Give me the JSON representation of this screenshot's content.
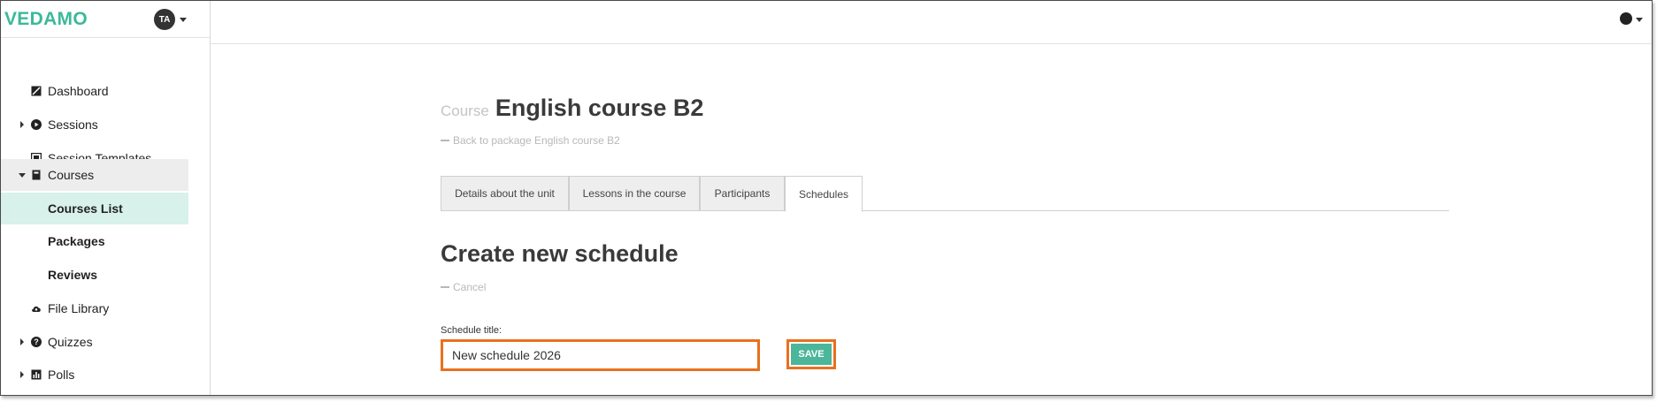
{
  "brand": {
    "logo_text": "VEDAMO",
    "logo_color": "#3cb99a"
  },
  "user": {
    "avatar_initials": "TA"
  },
  "sidebar": {
    "items": [
      {
        "label": "Dashboard",
        "icon": "dashboard-icon",
        "expandable": false
      },
      {
        "label": "Sessions",
        "icon": "play-circle-icon",
        "expandable": true,
        "expanded": false
      },
      {
        "label": "Session Templates",
        "icon": "template-icon",
        "expandable": false
      },
      {
        "label": "Courses",
        "icon": "book-icon",
        "expandable": true,
        "expanded": true
      },
      {
        "label": "Courses List",
        "sub": true,
        "active": true
      },
      {
        "label": "Packages",
        "sub": true
      },
      {
        "label": "Reviews",
        "sub": true
      },
      {
        "label": "File Library",
        "icon": "cloud-icon",
        "expandable": false
      },
      {
        "label": "Quizzes",
        "icon": "question-circle-icon",
        "expandable": true,
        "expanded": false
      },
      {
        "label": "Polls",
        "icon": "bar-chart-icon",
        "expandable": true,
        "expanded": false
      }
    ]
  },
  "topbar": {
    "language_icon": "globe-icon"
  },
  "course": {
    "kicker": "Course",
    "title": "English course B2",
    "back_link": "Back to package English course B2"
  },
  "tabs": [
    {
      "label": "Details about the unit",
      "active": false
    },
    {
      "label": "Lessons in the course",
      "active": false
    },
    {
      "label": "Participants",
      "active": false
    },
    {
      "label": "Schedules",
      "active": true
    }
  ],
  "form": {
    "heading": "Create new schedule",
    "cancel_link": "Cancel",
    "title_label": "Schedule title:",
    "title_value": "New schedule 2026",
    "save_label": "SAVE"
  },
  "colors": {
    "accent": "#4bb69a",
    "highlight": "#e8711d",
    "active_nav": "#d8f1ea"
  }
}
